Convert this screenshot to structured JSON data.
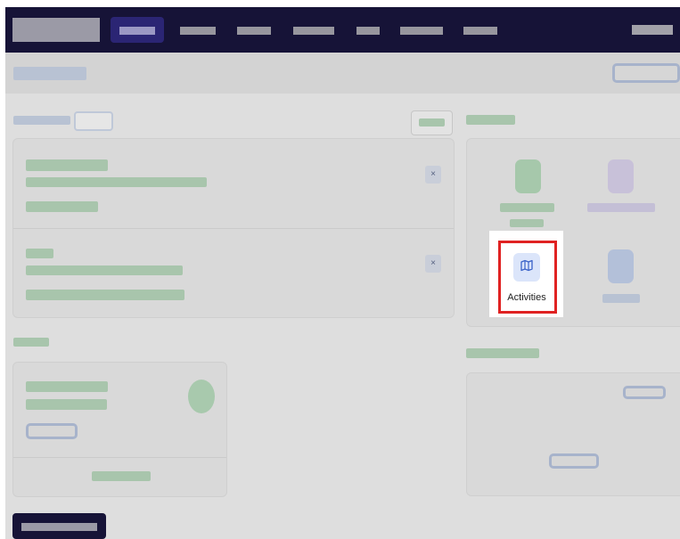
{
  "highlight": {
    "label": "Activities",
    "icon": "map-icon",
    "icon_color": "#3b63c8",
    "box_color": "#e02222"
  },
  "colors": {
    "nav_background": "#161337",
    "nav_active": "#2b2574",
    "overlay": "#dedede"
  }
}
